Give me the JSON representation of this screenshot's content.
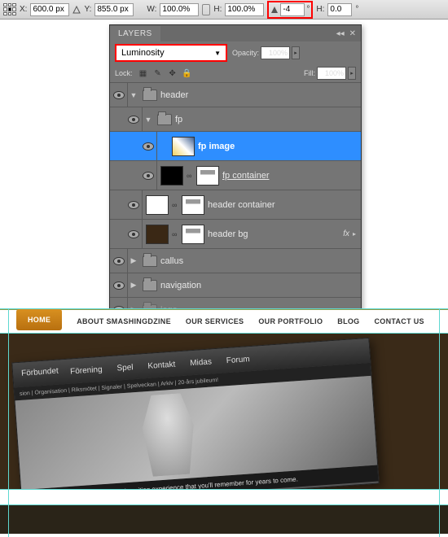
{
  "options_bar": {
    "x_label": "X:",
    "x_value": "600.0 px",
    "y_label": "Y:",
    "y_value": "855.0 px",
    "w_label": "W:",
    "w_value": "100.0%",
    "h_label": "H:",
    "h_value": "100.0%",
    "rotate_value": "-4",
    "rotate_unit": "°",
    "skew_h_label": "H:",
    "skew_h_value": "0.0",
    "skew_h_unit": "°"
  },
  "layers_panel": {
    "tab": "LAYERS",
    "blend_mode": "Luminosity",
    "opacity_label": "Opacity:",
    "opacity_value": "100%",
    "lock_label": "Lock:",
    "fill_label": "Fill:",
    "fill_value": "100%",
    "layers": {
      "header": "header",
      "fp": "fp",
      "fp_image": "fp image",
      "fp_container": "fp container",
      "header_container": "header container",
      "header_bg": "header bg",
      "fx": "fx",
      "callus": "callus",
      "navigation": "navigation",
      "logo": "logo"
    }
  },
  "mockup": {
    "nav": {
      "home": "HOME",
      "about": "ABOUT SMASHINGDZINE",
      "services": "OUR SERVICES",
      "portfolio": "OUR PORTFOLIO",
      "blog": "BLOG",
      "contact": "CONTACT US"
    },
    "hero_nav": {
      "forbundet": "Förbundet",
      "forening": "Förening",
      "spel": "Spel",
      "kontakt": "Kontakt",
      "midas": "Midas",
      "forum": "Forum"
    },
    "hero_sub": "sion | Organisation | Riksmötet | Signaler | Spelveckan | Arkiv | 20-års jubileum!",
    "hero_caption": "Assasin's Creed is a beautiful and exciting experience that you'll remember for years to come.",
    "footer_text": ""
  }
}
